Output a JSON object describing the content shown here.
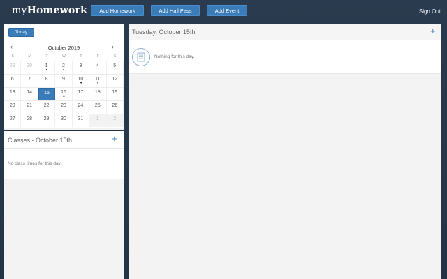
{
  "header": {
    "logo_prefix": "my",
    "logo_bold": "Homework",
    "buttons": {
      "add_homework": "Add Homework",
      "add_hall_pass": "Add Hall Pass",
      "add_event": "Add Event"
    },
    "sign_out": "Sign Out"
  },
  "calendar": {
    "today_label": "Today",
    "prev_icon": "‹",
    "next_icon": "›",
    "month_label": "October 2019",
    "weekdays": [
      "S",
      "M",
      "T",
      "W",
      "T",
      "F",
      "S"
    ],
    "weeks": [
      [
        {
          "d": "29",
          "state": "muted"
        },
        {
          "d": "30",
          "state": "muted"
        },
        {
          "d": "1",
          "dots": "•"
        },
        {
          "d": "2",
          "dots": "•"
        },
        {
          "d": "3"
        },
        {
          "d": "4"
        },
        {
          "d": "5"
        }
      ],
      [
        {
          "d": "6"
        },
        {
          "d": "7"
        },
        {
          "d": "8"
        },
        {
          "d": "9"
        },
        {
          "d": "10",
          "dots": "••"
        },
        {
          "d": "11",
          "dots": "•"
        },
        {
          "d": "12"
        }
      ],
      [
        {
          "d": "13"
        },
        {
          "d": "14"
        },
        {
          "d": "15",
          "state": "selected"
        },
        {
          "d": "16",
          "dots": "••"
        },
        {
          "d": "17"
        },
        {
          "d": "18"
        },
        {
          "d": "19"
        }
      ],
      [
        {
          "d": "20"
        },
        {
          "d": "21"
        },
        {
          "d": "22"
        },
        {
          "d": "23"
        },
        {
          "d": "24"
        },
        {
          "d": "25"
        },
        {
          "d": "26"
        }
      ],
      [
        {
          "d": "27"
        },
        {
          "d": "28"
        },
        {
          "d": "29"
        },
        {
          "d": "30"
        },
        {
          "d": "31"
        },
        {
          "d": "1",
          "state": "outside"
        },
        {
          "d": "2",
          "state": "outside"
        }
      ]
    ]
  },
  "classes": {
    "title": "Classes - October 15th",
    "add_icon": "+",
    "empty_text": "No class times for this day."
  },
  "day_view": {
    "title": "Tuesday, October 15th",
    "add_icon": "+",
    "empty_text": "Nothing for this day."
  },
  "colors": {
    "accent": "#3a7cb8",
    "background": "#243445"
  }
}
